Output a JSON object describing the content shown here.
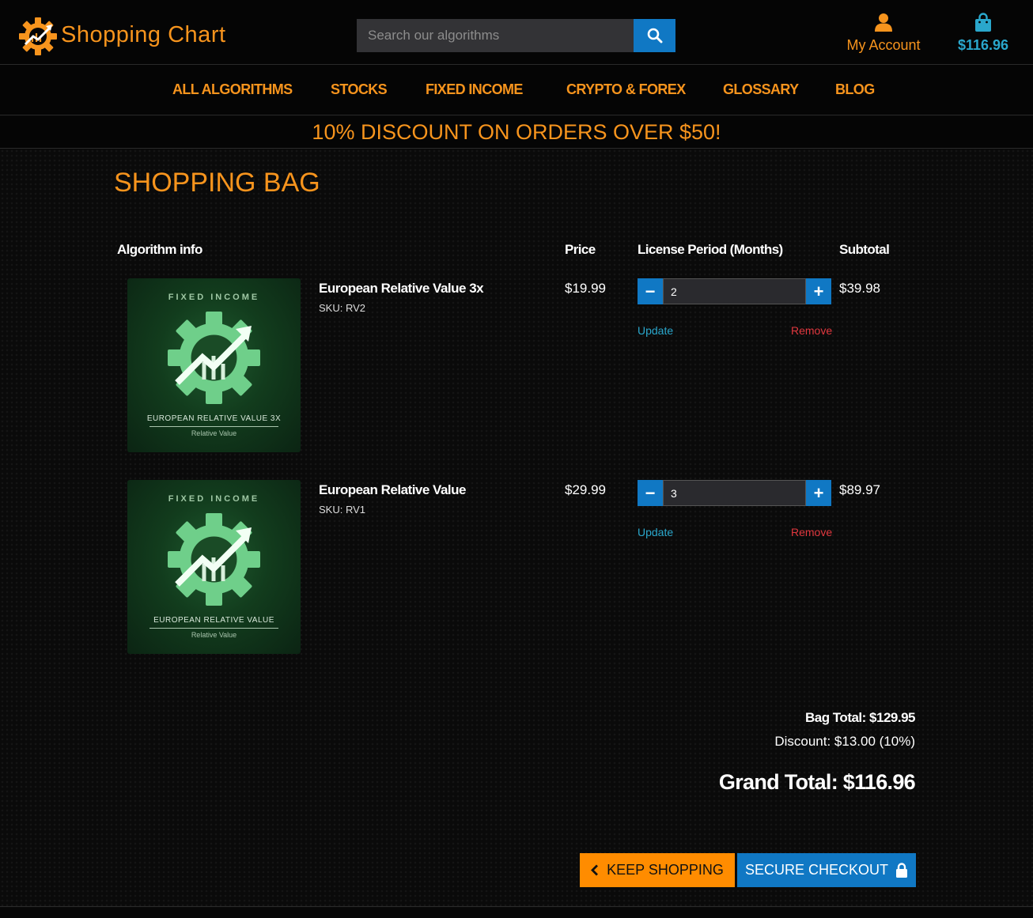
{
  "header": {
    "logo_text": "Shopping Chart",
    "logo_icon": "gear-chart-icon",
    "search_placeholder": "Search our algorithms",
    "search_value": "",
    "search_icon": "search-icon",
    "account_label": "My Account",
    "account_icon": "user-icon",
    "cart_total": "$116.96",
    "cart_icon": "shopping-bag-icon"
  },
  "nav": {
    "items": [
      {
        "label": "ALL ALGORITHMS"
      },
      {
        "label": "STOCKS"
      },
      {
        "label": "FIXED INCOME"
      },
      {
        "label": "CRYPTO & FOREX"
      },
      {
        "label": "GLOSSARY"
      },
      {
        "label": "BLOG"
      }
    ]
  },
  "banner": {
    "text": "10% DISCOUNT ON ORDERS OVER $50!"
  },
  "bag": {
    "title": "SHOPPING BAG",
    "columns": {
      "info": "Algorithm info",
      "price": "Price",
      "period": "License Period (Months)",
      "subtotal": "Subtotal"
    },
    "items": [
      {
        "thumb_category": "FIXED INCOME",
        "thumb_name": "EUROPEAN RELATIVE VALUE 3X",
        "thumb_sub": "Relative Value",
        "name": "European Relative Value 3x",
        "sku": "SKU: RV2",
        "price": "$19.99",
        "qty": "2",
        "update_label": "Update",
        "remove_label": "Remove",
        "subtotal": "$39.98"
      },
      {
        "thumb_category": "FIXED INCOME",
        "thumb_name": "EUROPEAN RELATIVE VALUE",
        "thumb_sub": "Relative Value",
        "name": "European Relative Value",
        "sku": "SKU: RV1",
        "price": "$29.99",
        "qty": "3",
        "update_label": "Update",
        "remove_label": "Remove",
        "subtotal": "$89.97"
      }
    ],
    "qty_minus": "−",
    "qty_plus": "+"
  },
  "totals": {
    "bag_total": "Bag Total: $129.95",
    "discount": "Discount: $13.00 (10%)",
    "grand_total": "Grand Total: $116.96"
  },
  "actions": {
    "keep_shopping": "KEEP SHOPPING",
    "keep_icon": "chevron-left-icon",
    "secure_checkout": "SECURE CHECKOUT",
    "checkout_icon": "lock-icon"
  },
  "colors": {
    "accent_orange": "#f7941d",
    "accent_blue": "#1078c4",
    "link_teal": "#2aa7cc",
    "remove_red": "#e2383f"
  }
}
